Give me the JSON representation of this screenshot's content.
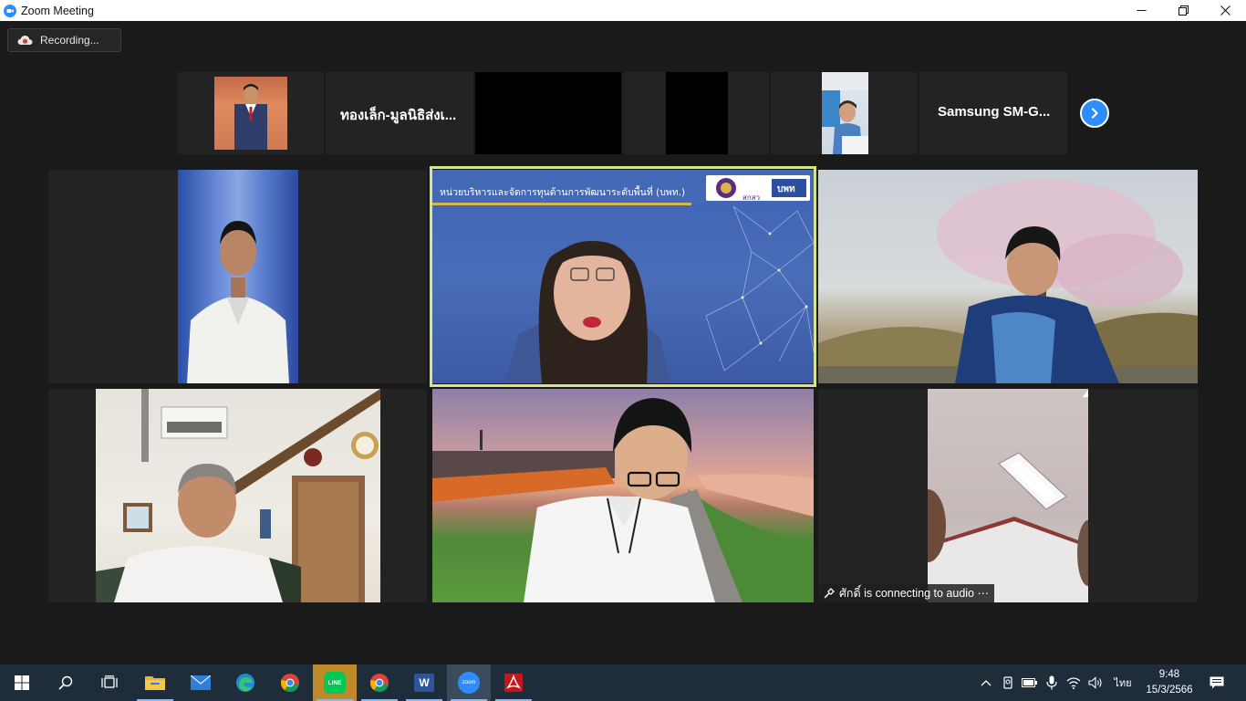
{
  "window": {
    "title": "Zoom Meeting",
    "controls": [
      "minimize-icon",
      "restore-icon",
      "close-icon"
    ]
  },
  "recording": {
    "label": "Recording..."
  },
  "gallery_strip": {
    "tiles": [
      {
        "type": "video",
        "name": ""
      },
      {
        "type": "name",
        "name": "ทองเล็ก-มูลนิธิส่งเ..."
      },
      {
        "type": "black",
        "name": ""
      },
      {
        "type": "black",
        "name": ""
      },
      {
        "type": "video",
        "name": ""
      },
      {
        "type": "name",
        "name": "Samsung  SM-G..."
      }
    ],
    "next_icon": "chevron-right-icon"
  },
  "active_speaker": {
    "slide_header": "หน่วยบริหารและจัดการทุนด้านการพัฒนาระดับพื้นที่ (บพท.)",
    "logo_text_1": "สกสว",
    "logo_text_2": "บพท"
  },
  "status": {
    "text": "ศักดิ์ is connecting to audio ⋯",
    "icon": "audio-connecting-icon"
  },
  "taskbar": {
    "apps": [
      "windows-start-icon",
      "search-icon",
      "task-view-icon",
      "file-explorer-icon",
      "mail-icon",
      "edge-icon",
      "chrome-icon",
      "line-icon",
      "chrome-icon",
      "word-icon",
      "zoom-icon",
      "acrobat-icon"
    ],
    "line_label": "LINE",
    "zoom_label": "zoom",
    "word_label": "W",
    "language": "ไทย",
    "time": "9:48",
    "date": "15/3/2566"
  }
}
